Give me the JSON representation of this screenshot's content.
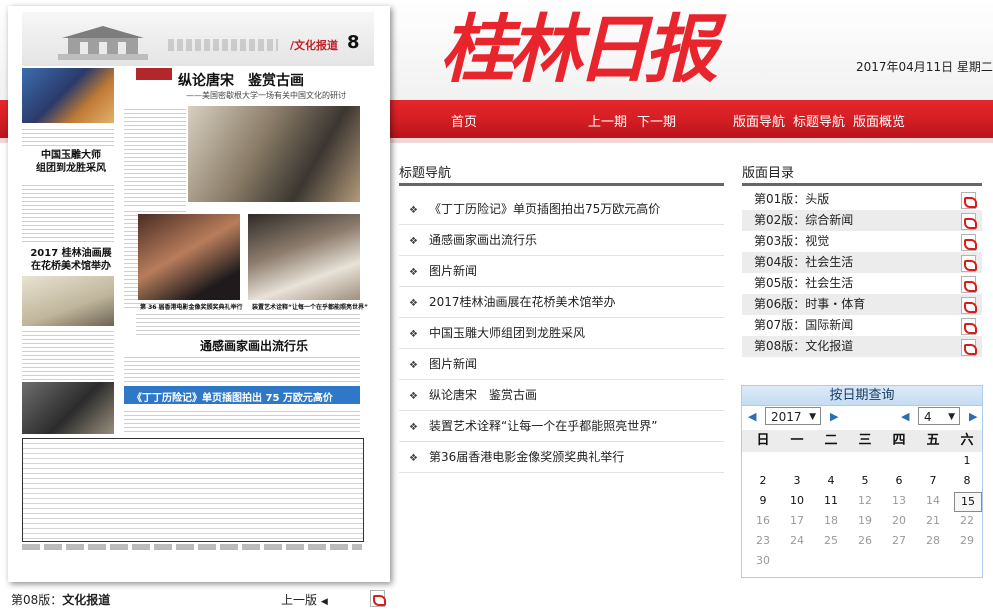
{
  "masthead": "桂林日报",
  "issue_date": "2017年04月11日 星期二",
  "nav": {
    "home": "首页",
    "prev_issue": "上一期",
    "next_issue": "下一期",
    "page_nav": "版面导航",
    "title_nav": "标题导航",
    "page_overview": "版面概览"
  },
  "title_nav": {
    "heading": "标题导航",
    "items": [
      "《丁丁历险记》单页插图拍出75万欧元高价",
      "通感画家画出流行乐",
      "图片新闻",
      "2017桂林油画展在花桥美术馆举办",
      "中国玉雕大师组团到龙胜采风",
      "图片新闻",
      "纵论唐宋　鉴赏古画",
      "装置艺术诠释“让每一个在乎都能照亮世界”",
      "第36届香港电影金像奖颁奖典礼举行"
    ]
  },
  "directory": {
    "heading": "版面目录",
    "items": [
      "第01版：头版",
      "第02版：综合新闻",
      "第03版：视觉",
      "第04版：社会生活",
      "第05版：社会生活",
      "第06版：时事・体育",
      "第07版：国际新闻",
      "第08版：文化报道"
    ]
  },
  "calendar": {
    "title": "按日期查询",
    "year": "2017",
    "month": "4",
    "weekdays": [
      "日",
      "一",
      "二",
      "三",
      "四",
      "五",
      "六"
    ],
    "selected_day": "15",
    "days": [
      [
        "",
        "",
        "",
        "",
        "",
        "",
        "1"
      ],
      [
        "2",
        "3",
        "4",
        "5",
        "6",
        "7",
        "8"
      ],
      [
        "9",
        "10",
        "11",
        "12",
        "13",
        "14",
        "15"
      ],
      [
        "16",
        "17",
        "18",
        "19",
        "20",
        "21",
        "22"
      ],
      [
        "23",
        "24",
        "25",
        "26",
        "27",
        "28",
        "29"
      ],
      [
        "30",
        "",
        "",
        "",
        "",
        "",
        ""
      ]
    ],
    "last_active_day": 11
  },
  "current_page": {
    "label": "第08版：",
    "name": "文化报道",
    "prev_page": "上一版"
  },
  "page_image": {
    "page_label": "/文化报道",
    "page_number": "8",
    "main_headline": "纵论唐宋　鉴赏古画",
    "sub_headline": "——美国密歇根大学一场有关中国文化的研讨",
    "left_story_headline": "中国玉雕大师\n组团到龙胜采风",
    "left_story2_headline": "2017 桂林油画展\n在花桥美术馆举办",
    "caption_a": "第 36 届香港电影金像奖颁奖典礼举行",
    "caption_b": "装置艺术诠释“让每一个在乎都能照亮世界”",
    "headline_2": "通感画家画出流行乐",
    "headline_3": "《丁丁历险记》单页插图拍出 75 万欧元高价"
  }
}
